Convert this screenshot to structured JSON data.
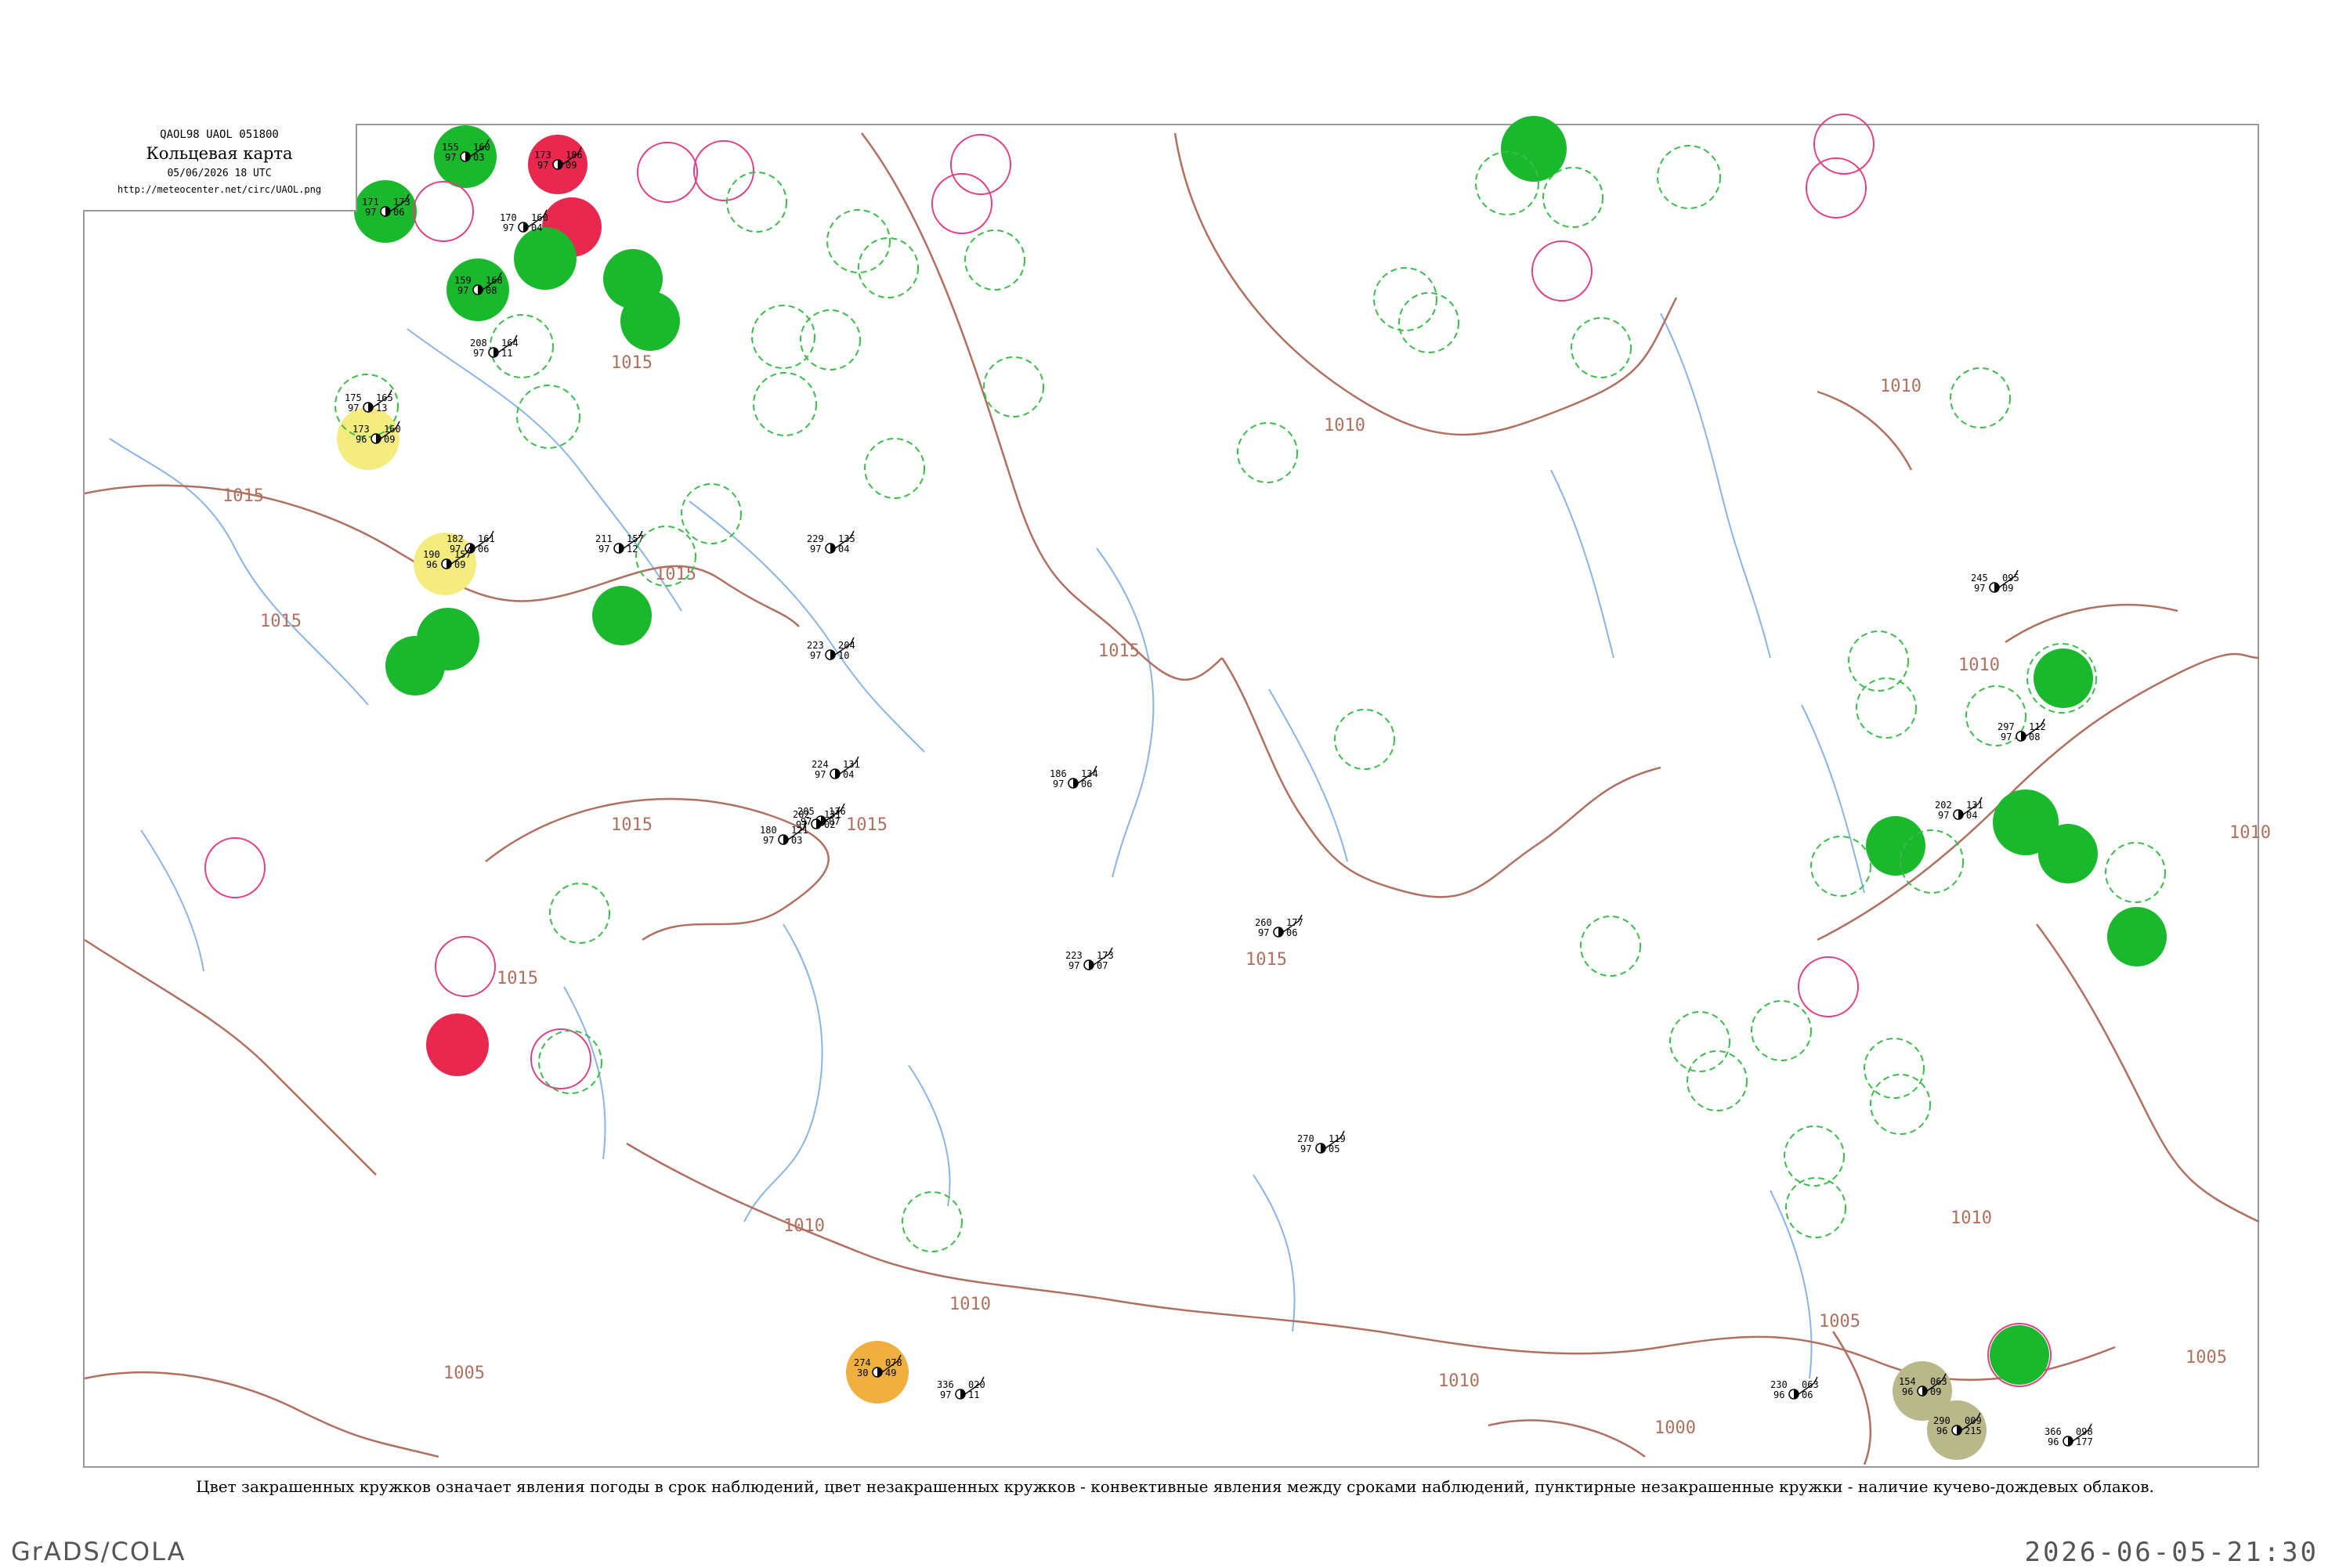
{
  "header": {
    "code": "QAOL98  UAOL  051800",
    "title": "Кольцевая карта",
    "date": "05/06/2026 18 UTC",
    "url": "http://meteocenter.net/circ/UAOL.png"
  },
  "caption": "Цвет закрашенных кружков означает явления погоды в срок наблюдений, цвет незакрашенных кружков - конвективные явления между сроками наблюдений, пунктирные незакрашенные кружки - наличие кучево-дождевых облаков.",
  "credit_left": "GrADS/COLA",
  "credit_right": "2026-06-05-21:30",
  "colors": {
    "isobar": "#b07060",
    "river": "#8ab4e8",
    "frame": "#9a9a9a",
    "rain": "#1ab82c",
    "storm": "#e8284e",
    "fog": "#f5ec80",
    "dust": "#f0b040",
    "haze": "#b8b88a",
    "dashed": "#3cbc4c",
    "storm_ring": "#e04080"
  },
  "isobar_labels": [
    "1015",
    "1015",
    "1015",
    "1015",
    "1015",
    "1015",
    "1015",
    "1015",
    "1015",
    "1010",
    "1010",
    "1010",
    "1010",
    "1010",
    "1010",
    "1010",
    "1010",
    "1005",
    "1005",
    "1005",
    "1000"
  ],
  "stations": [
    {
      "t": "171",
      "p": "173",
      "n": "97",
      "td": "06"
    },
    {
      "t": "155",
      "p": "160",
      "n": "97",
      "td": "03"
    },
    {
      "t": "173",
      "p": "186",
      "n": "97",
      "td": "09"
    },
    {
      "t": "170",
      "p": "160",
      "n": "97",
      "td": "04"
    },
    {
      "t": "159",
      "p": "168",
      "n": "97",
      "td": "08"
    },
    {
      "t": "208",
      "p": "164",
      "n": "97",
      "td": "11"
    },
    {
      "t": "175",
      "p": "165",
      "n": "97",
      "td": "13"
    },
    {
      "t": "173",
      "p": "160",
      "n": "96",
      "td": "09"
    },
    {
      "t": "182",
      "p": "161",
      "n": "97",
      "td": "06"
    },
    {
      "t": "190",
      "p": "157",
      "n": "96",
      "td": "09"
    },
    {
      "t": "211",
      "p": "157",
      "n": "97",
      "td": "12"
    },
    {
      "t": "229",
      "p": "135",
      "n": "97",
      "td": "04"
    },
    {
      "t": "223",
      "p": "204",
      "n": "97",
      "td": "10"
    },
    {
      "t": "180",
      "p": "121",
      "n": "97",
      "td": "03"
    },
    {
      "t": "205",
      "p": "136",
      "n": "97",
      "td": "07"
    },
    {
      "t": "224",
      "p": "131",
      "n": "97",
      "td": "04"
    },
    {
      "t": "202",
      "p": "131",
      "n": "97",
      "td": "02"
    },
    {
      "t": "186",
      "p": "134",
      "n": "97",
      "td": "06"
    },
    {
      "t": "260",
      "p": "177",
      "n": "97",
      "td": "06"
    },
    {
      "t": "223",
      "p": "173",
      "n": "97",
      "td": "07"
    },
    {
      "t": "270",
      "p": "119",
      "n": "97",
      "td": "05"
    },
    {
      "t": "274",
      "p": "078",
      "n": "30",
      "td": "49"
    },
    {
      "t": "336",
      "p": "020",
      "n": "97",
      "td": "11"
    },
    {
      "t": "154",
      "p": "063",
      "n": "96",
      "td": "09"
    },
    {
      "t": "230",
      "p": "063",
      "n": "96",
      "td": "06"
    },
    {
      "t": "290",
      "p": "009",
      "n": "96",
      "td": "215"
    },
    {
      "t": "366",
      "p": "098",
      "n": "96",
      "td": "177"
    },
    {
      "t": "245",
      "p": "095",
      "n": "97",
      "td": "09"
    },
    {
      "t": "297",
      "p": "112",
      "n": "97",
      "td": "08"
    },
    {
      "t": "202",
      "p": "131",
      "n": "97",
      "td": "04"
    }
  ]
}
